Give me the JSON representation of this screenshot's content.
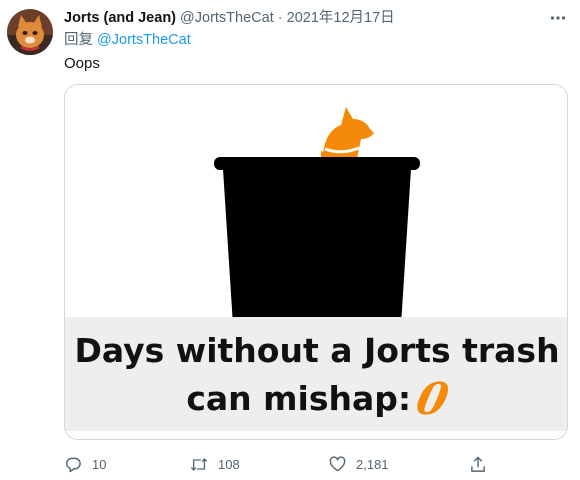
{
  "tweet": {
    "display_name": "Jorts (and Jean)",
    "handle": "@JortsTheCat",
    "separator": "·",
    "timestamp": "2021年12月17日",
    "reply_prefix": "回复",
    "reply_target": "@JortsTheCat",
    "text": "Oops"
  },
  "media": {
    "caption_line1": "Days without a Jorts trash",
    "caption_line2": "can mishap:",
    "counter_value": "0"
  },
  "actions": {
    "reply_count": "10",
    "retweet_count": "108",
    "like_count": "2,181"
  },
  "colors": {
    "accent": "#1d9bf0",
    "secondary_text": "#536471",
    "cat_orange": "#f58a0a",
    "trash_can": "#000000"
  },
  "icons": {
    "more": "more-icon",
    "reply": "reply-icon",
    "retweet": "retweet-icon",
    "like": "heart-icon",
    "share": "share-icon"
  }
}
